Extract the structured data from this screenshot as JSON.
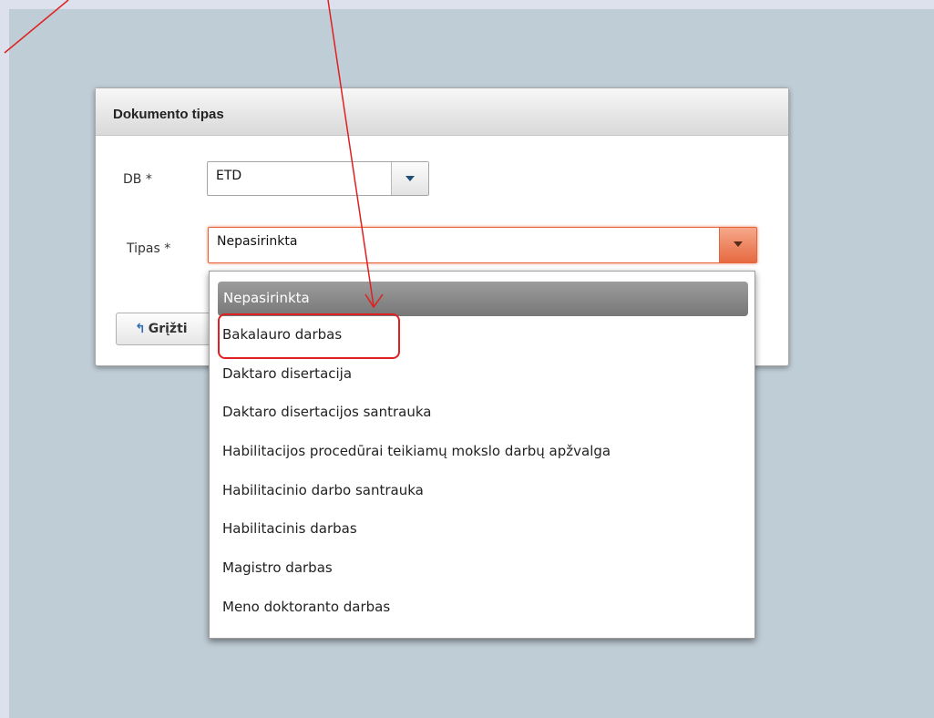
{
  "dialog": {
    "title": "Dokumento tipas",
    "db_label": "DB *",
    "db_value": "ETD",
    "tipas_label": "Tipas *",
    "tipas_value": "Nepasirinkta",
    "back_button": "Grįžti",
    "back_icon": "back-arrow-icon"
  },
  "dropdown": {
    "options": [
      "Nepasirinkta",
      "Bakalauro darbas",
      "Daktaro disertacija",
      "Daktaro disertacijos santrauka",
      "Habilitacijos procedūrai teikiamų mokslo darbų apžvalga",
      "Habilitacinio darbo santrauka",
      "Habilitacinis darbas",
      "Magistro darbas",
      "Meno doktoranto darbas"
    ],
    "selected_index": 0,
    "highlighted_option": "Bakalauro darbas"
  },
  "colors": {
    "annotation": "#e02020",
    "focus": "#e8643c",
    "selected_item": "#8a8a8a"
  }
}
